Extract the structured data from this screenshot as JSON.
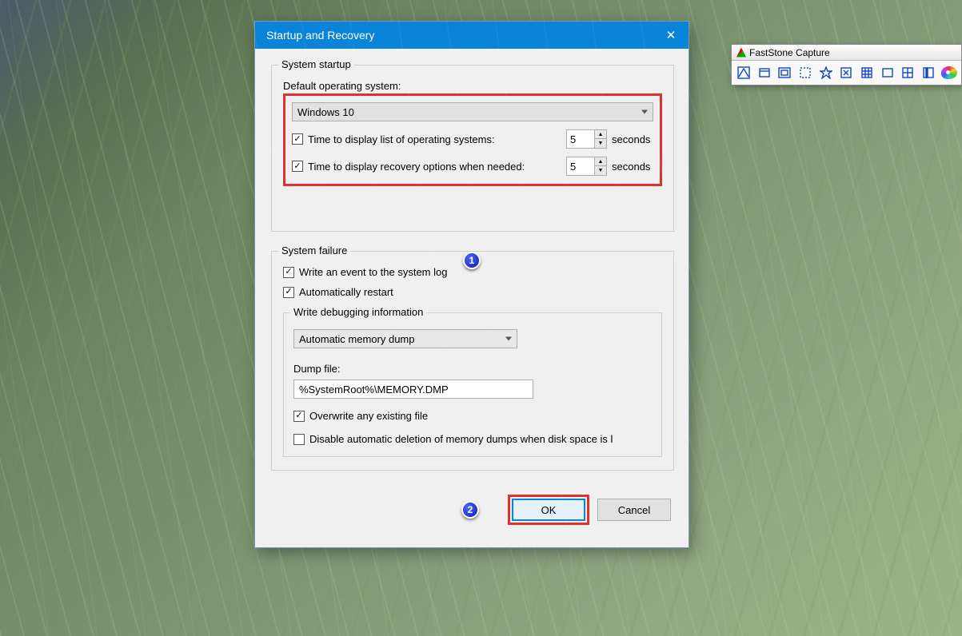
{
  "dialog": {
    "title": "Startup and Recovery",
    "group_startup": {
      "label": "System startup",
      "default_os_label": "Default operating system:",
      "default_os_value": "Windows 10",
      "time_list_label": "Time to display list of operating systems:",
      "time_list_value": "5",
      "time_recovery_label": "Time to display recovery options when needed:",
      "time_recovery_value": "5",
      "seconds_label": "seconds"
    },
    "group_failure": {
      "label": "System failure",
      "write_event_label": "Write an event to the system log",
      "auto_restart_label": "Automatically restart",
      "debug_group_label": "Write debugging information",
      "dump_type_value": "Automatic memory dump",
      "dump_file_label": "Dump file:",
      "dump_file_value": "%SystemRoot%\\MEMORY.DMP",
      "overwrite_label": "Overwrite any existing file",
      "disable_delete_label": "Disable automatic deletion of memory dumps when disk space is l"
    },
    "callouts": {
      "one": "1",
      "two": "2"
    },
    "buttons": {
      "ok": "OK",
      "cancel": "Cancel"
    }
  },
  "faststone": {
    "title": "FastStone Capture"
  }
}
